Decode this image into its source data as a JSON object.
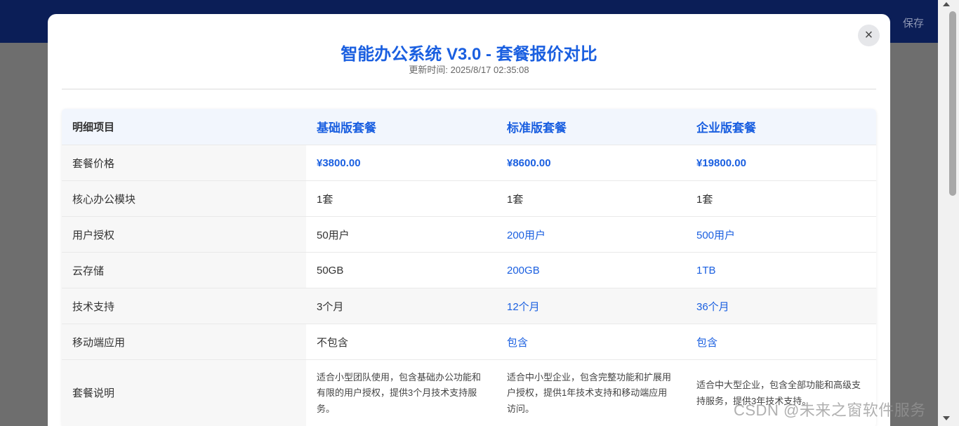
{
  "topbar": {
    "save_label": "保存"
  },
  "modal": {
    "title": "智能办公系统 V3.0 - 套餐报价对比",
    "updated": "更新时间: 2025/8/17 02:35:08",
    "close_label": "×"
  },
  "table": {
    "header": [
      "明细项目",
      "基础版套餐",
      "标准版套餐",
      "企业版套餐"
    ],
    "rows": [
      {
        "label": "套餐价格",
        "basic": "¥3800.00",
        "standard": "¥8600.00",
        "enterprise": "¥19800.00"
      },
      {
        "label": "核心办公模块",
        "basic": "1套",
        "standard": "1套",
        "enterprise": "1套"
      },
      {
        "label": "用户授权",
        "basic": "50用户",
        "standard": "200用户",
        "enterprise": "500用户"
      },
      {
        "label": "云存储",
        "basic": "50GB",
        "standard": "200GB",
        "enterprise": "1TB"
      },
      {
        "label": "技术支持",
        "basic": "3个月",
        "standard": "12个月",
        "enterprise": "36个月"
      },
      {
        "label": "移动端应用",
        "basic": "不包含",
        "standard": "包含",
        "enterprise": "包含"
      },
      {
        "label": "套餐说明",
        "basic": "适合小型团队使用，包含基础办公功能和有限的用户授权，提供3个月技术支持服务。",
        "standard": "适合中小型企业，包含完整功能和扩展用户授权，提供1年技术支持和移动端应用访问。",
        "enterprise": "适合中大型企业，包含全部功能和高级支持服务，提供3年技术支持。"
      }
    ]
  },
  "watermark": "CSDN @未来之窗软件服务",
  "colors": {
    "accent": "#1a5fe0",
    "topbar": "#0b1e57"
  }
}
